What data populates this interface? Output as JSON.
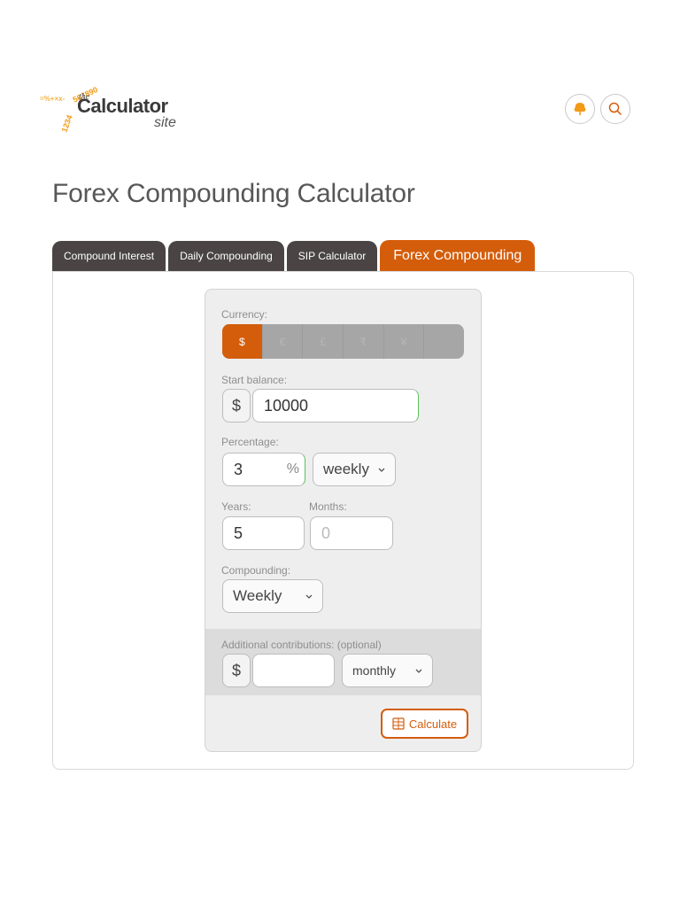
{
  "header": {
    "logo": {
      "the": "the",
      "calculator": "Calculator",
      "site": "site",
      "digits": "1234567890",
      "symbols": "=%+×x-"
    },
    "icons": [
      "tree-icon",
      "search-icon"
    ]
  },
  "page_title": "Forex Compounding Calculator",
  "tabs": [
    {
      "label": "Compound Interest",
      "active": false
    },
    {
      "label": "Daily Compounding",
      "active": false
    },
    {
      "label": "SIP Calculator",
      "active": false
    },
    {
      "label": "Forex Compounding",
      "active": true
    }
  ],
  "form": {
    "currency": {
      "label": "Currency:",
      "options": [
        "$",
        "€",
        "£",
        "₹",
        "¥",
        ""
      ],
      "selected": "$"
    },
    "start_balance": {
      "label": "Start balance:",
      "prefix": "$",
      "value": "10000"
    },
    "percentage": {
      "label": "Percentage:",
      "value": "3",
      "suffix": "%",
      "period": "weekly"
    },
    "years": {
      "label": "Years:",
      "value": "5"
    },
    "months": {
      "label": "Months:",
      "placeholder": "0"
    },
    "compounding": {
      "label": "Compounding:",
      "value": "Weekly"
    },
    "contributions": {
      "label": "Additional contributions: (optional)",
      "prefix": "$",
      "value": "",
      "period": "monthly"
    },
    "calculate_label": "Calculate"
  },
  "colors": {
    "accent": "#d45d0b",
    "tab_dark": "#4a4444",
    "card_bg": "#eeeeee",
    "logo_orange": "#f39a16"
  }
}
